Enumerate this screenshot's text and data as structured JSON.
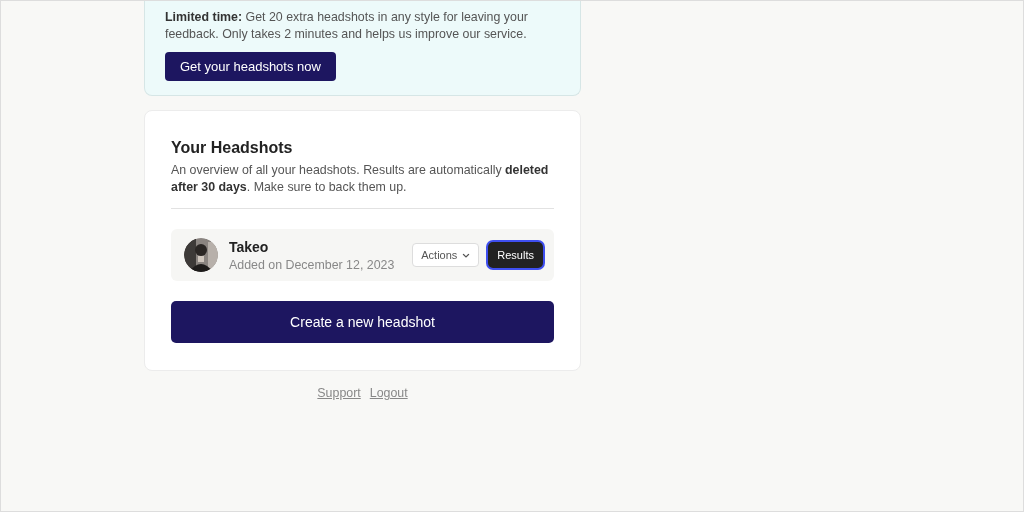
{
  "promo": {
    "text": "**Limited time:** Get 20 extra headshots in any style for leaving your feedback. Only takes 2 minutes and helps us improve our service.",
    "button": "Get your headshots now"
  },
  "headshots": {
    "title": "Your Headshots",
    "description": "An overview of all your headshots. Results are automatically **deleted after 30 days**. Make sure to back them up.",
    "items": [
      {
        "name": "Takeo",
        "added": "Added on December 12, 2023",
        "actions": "Actions",
        "results": "Results",
        "focused": true
      }
    ],
    "create_button": "Create a new headshot"
  },
  "footer_links": [
    "Support",
    "Logout"
  ]
}
